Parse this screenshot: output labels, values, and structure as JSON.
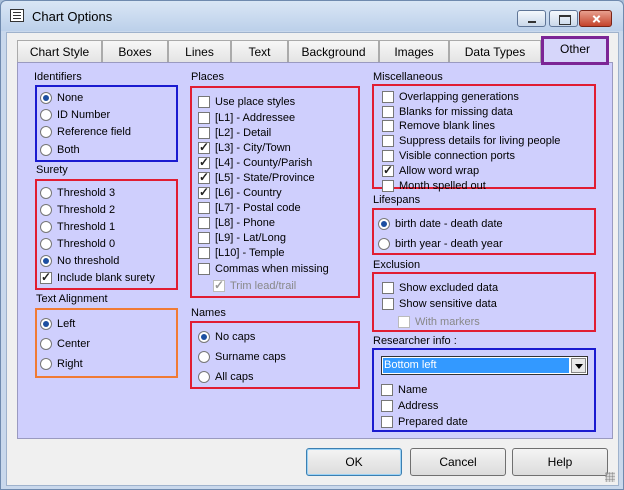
{
  "window": {
    "title": "Chart Options"
  },
  "tabs": [
    {
      "label": "Chart Style"
    },
    {
      "label": "Boxes"
    },
    {
      "label": "Lines"
    },
    {
      "label": "Text"
    },
    {
      "label": "Background"
    },
    {
      "label": "Images"
    },
    {
      "label": "Data Types"
    },
    {
      "label": "Other",
      "active": true
    }
  ],
  "identifiers": {
    "title": "Identifiers",
    "options": [
      "None",
      "ID Number",
      "Reference field",
      "Both"
    ],
    "selected": "None"
  },
  "surety": {
    "title": "Surety",
    "options": [
      "Threshold 3",
      "Threshold 2",
      "Threshold 1",
      "Threshold 0",
      "No threshold"
    ],
    "selected": "No threshold",
    "include_blank": {
      "label": "Include blank surety",
      "checked": true
    }
  },
  "text_alignment": {
    "title": "Text Alignment",
    "options": [
      "Left",
      "Center",
      "Right"
    ],
    "selected": "Left"
  },
  "places": {
    "title": "Places",
    "items": [
      {
        "label": "Use place styles",
        "checked": false
      },
      {
        "label": "[L1] - Addressee",
        "checked": false
      },
      {
        "label": "[L2] - Detail",
        "checked": false
      },
      {
        "label": "[L3] - City/Town",
        "checked": true
      },
      {
        "label": "[L4] - County/Parish",
        "checked": true
      },
      {
        "label": "[L5] - State/Province",
        "checked": true
      },
      {
        "label": "[L6] - Country",
        "checked": true
      },
      {
        "label": "[L7] - Postal code",
        "checked": false
      },
      {
        "label": "[L8] - Phone",
        "checked": false
      },
      {
        "label": "[L9] - Lat/Long",
        "checked": false
      },
      {
        "label": "[L10] - Temple",
        "checked": false
      },
      {
        "label": "Commas when missing",
        "checked": false
      }
    ],
    "trim": {
      "label": "Trim lead/trail",
      "checked": true
    }
  },
  "names": {
    "title": "Names",
    "options": [
      "No caps",
      "Surname caps",
      "All caps"
    ],
    "selected": "No caps"
  },
  "misc": {
    "title": "Miscellaneous",
    "items": [
      {
        "label": "Overlapping generations",
        "checked": false
      },
      {
        "label": "Blanks for missing data",
        "checked": false
      },
      {
        "label": "Remove blank lines",
        "checked": false
      },
      {
        "label": "Suppress details for living people",
        "checked": false
      },
      {
        "label": "Visible connection ports",
        "checked": false
      },
      {
        "label": "Allow word wrap",
        "checked": true
      },
      {
        "label": "Month spelled out",
        "checked": false
      }
    ]
  },
  "lifespans": {
    "title": "Lifespans",
    "options": [
      "birth date - death date",
      "birth year - death year"
    ],
    "selected": "birth date - death date"
  },
  "exclusion": {
    "title": "Exclusion",
    "items": [
      {
        "label": "Show excluded data",
        "checked": false
      },
      {
        "label": "Show sensitive data",
        "checked": false
      }
    ],
    "with_markers": {
      "label": "With markers",
      "checked": false
    }
  },
  "researcher": {
    "title": "Researcher info :",
    "position": "Bottom left",
    "items": [
      {
        "label": "Name",
        "checked": false
      },
      {
        "label": "Address",
        "checked": false
      },
      {
        "label": "Prepared date",
        "checked": false
      }
    ]
  },
  "buttons": {
    "ok": "OK",
    "cancel": "Cancel",
    "help": "Help"
  },
  "colors": {
    "panel": "#cfcffd",
    "red_box": "#e11d32",
    "blue_box": "#1a1ad0",
    "orange_box": "#f07b34",
    "tab_highlight": "#7c2595",
    "selection": "#3399ff"
  }
}
